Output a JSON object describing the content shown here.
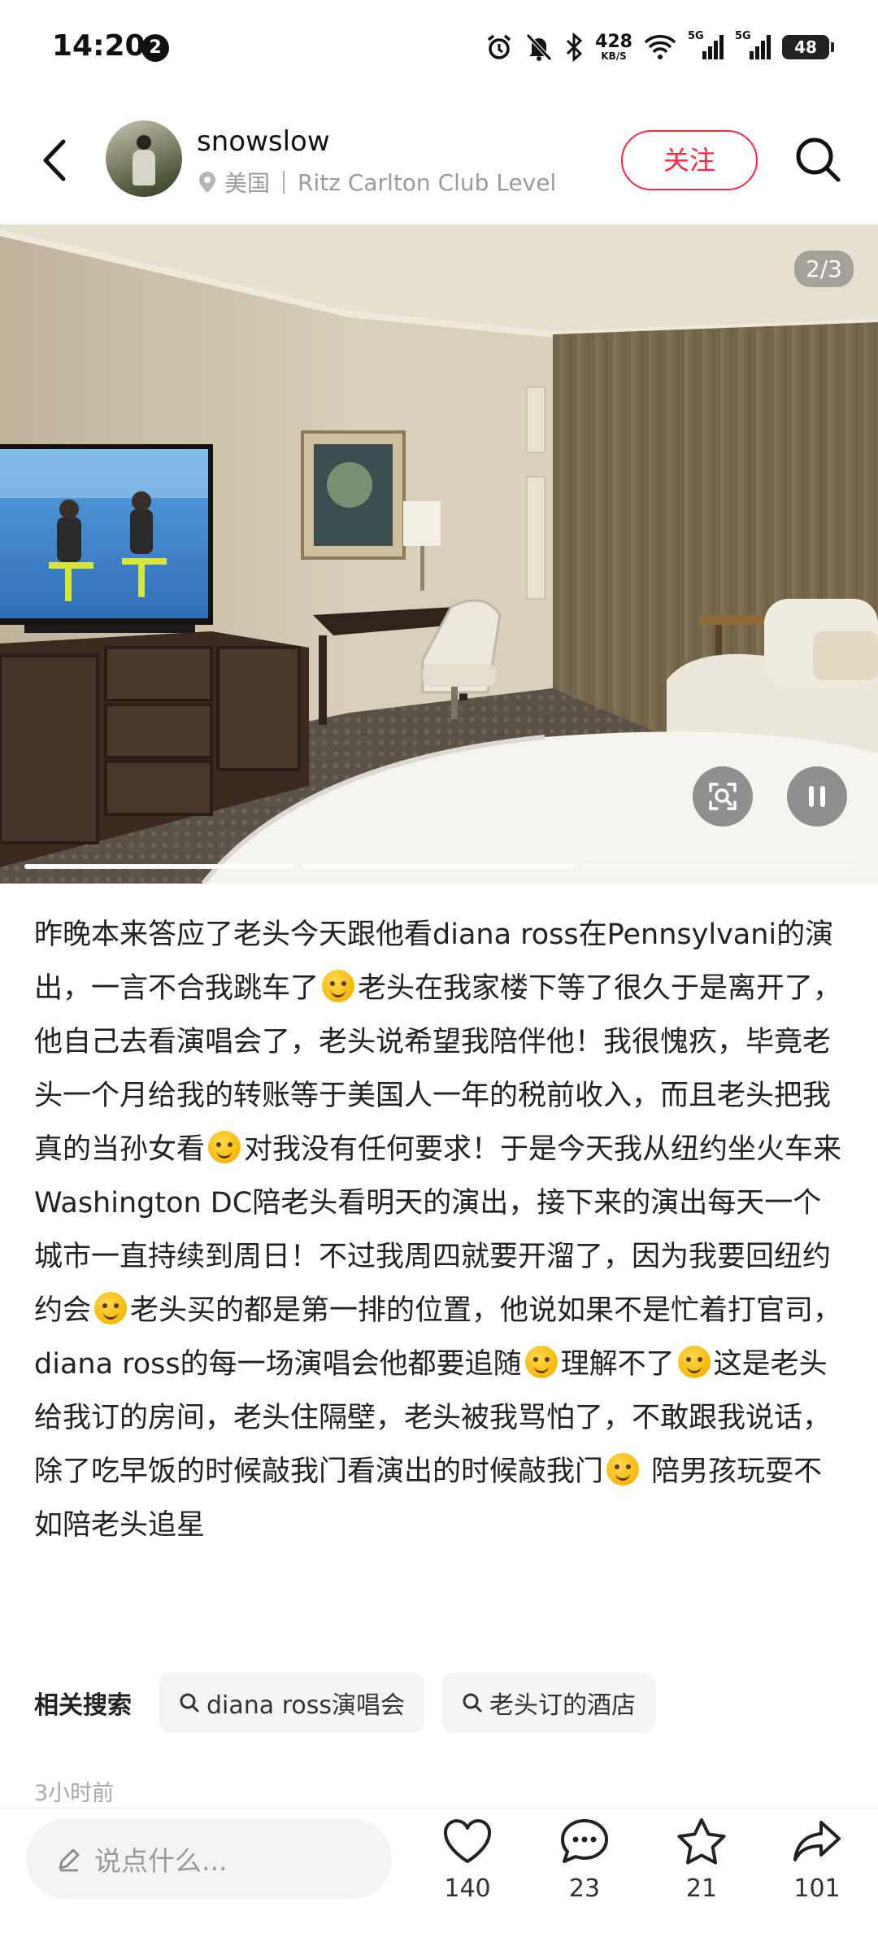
{
  "status_bar": {
    "time": "14:20",
    "notification_count": "2",
    "net_speed_value": "428",
    "net_speed_unit": "KB/S",
    "signal_1": "5G",
    "signal_2": "5G",
    "battery": "48"
  },
  "header": {
    "username": "snowslow",
    "location_country": "美国",
    "location_place": "Ritz Carlton Club Level",
    "follow_label": "关注"
  },
  "photo": {
    "counter": "2/3",
    "current_index": 2,
    "total": 3,
    "progress_fill": [
      1,
      1,
      0
    ]
  },
  "post": {
    "segments": [
      {
        "type": "text",
        "value": "昨晚本来答应了老头今天跟他看diana ross在Pennsylvani的演出，一言不合我跳车了"
      },
      {
        "type": "emoji",
        "value": "persevering-face"
      },
      {
        "type": "text",
        "value": "老头在我家楼下等了很久于是离开了，他自己去看演唱会了，老头说希望我陪伴他！我很愧疚，毕竟老头一个月给我的转账等于美国人一年的税前收入，而且老头把我真的当孙女看"
      },
      {
        "type": "emoji",
        "value": "persevering-face"
      },
      {
        "type": "text",
        "value": "对我没有任何要求！于是今天我从纽约坐火车来Washington DC陪老头看明天的演出，接下来的演出每天一个城市一直持续到周日！不过我周四就要开溜了，因为我要回纽约约会"
      },
      {
        "type": "emoji",
        "value": "grinning-face"
      },
      {
        "type": "text",
        "value": "老头买的都是第一排的位置，他说如果不是忙着打官司，diana ross的每一场演唱会他都要追随"
      },
      {
        "type": "emoji",
        "value": "persevering-face"
      },
      {
        "type": "text",
        "value": "理解不了"
      },
      {
        "type": "emoji",
        "value": "persevering-face"
      },
      {
        "type": "text",
        "value": "这是老头给我订的房间，老头住隔壁，老头被我骂怕了，不敢跟我说话，除了吃早饭的时候敲我门看演出的时候敲我门"
      },
      {
        "type": "emoji",
        "value": "rolling-laughing-face"
      },
      {
        "type": "text",
        "value": " 陪男孩玩耍不如陪老头追星"
      }
    ]
  },
  "related_search": {
    "label": "相关搜索",
    "items": [
      "diana ross演唱会",
      "老头订的酒店"
    ]
  },
  "time_ago": "3小时前",
  "bottom_bar": {
    "comment_placeholder": "说点什么...",
    "likes": "140",
    "comments": "23",
    "favorites": "21",
    "shares": "101"
  },
  "colors": {
    "accent": "#ff2442",
    "text": "#222222",
    "muted": "#9a9a9a"
  }
}
